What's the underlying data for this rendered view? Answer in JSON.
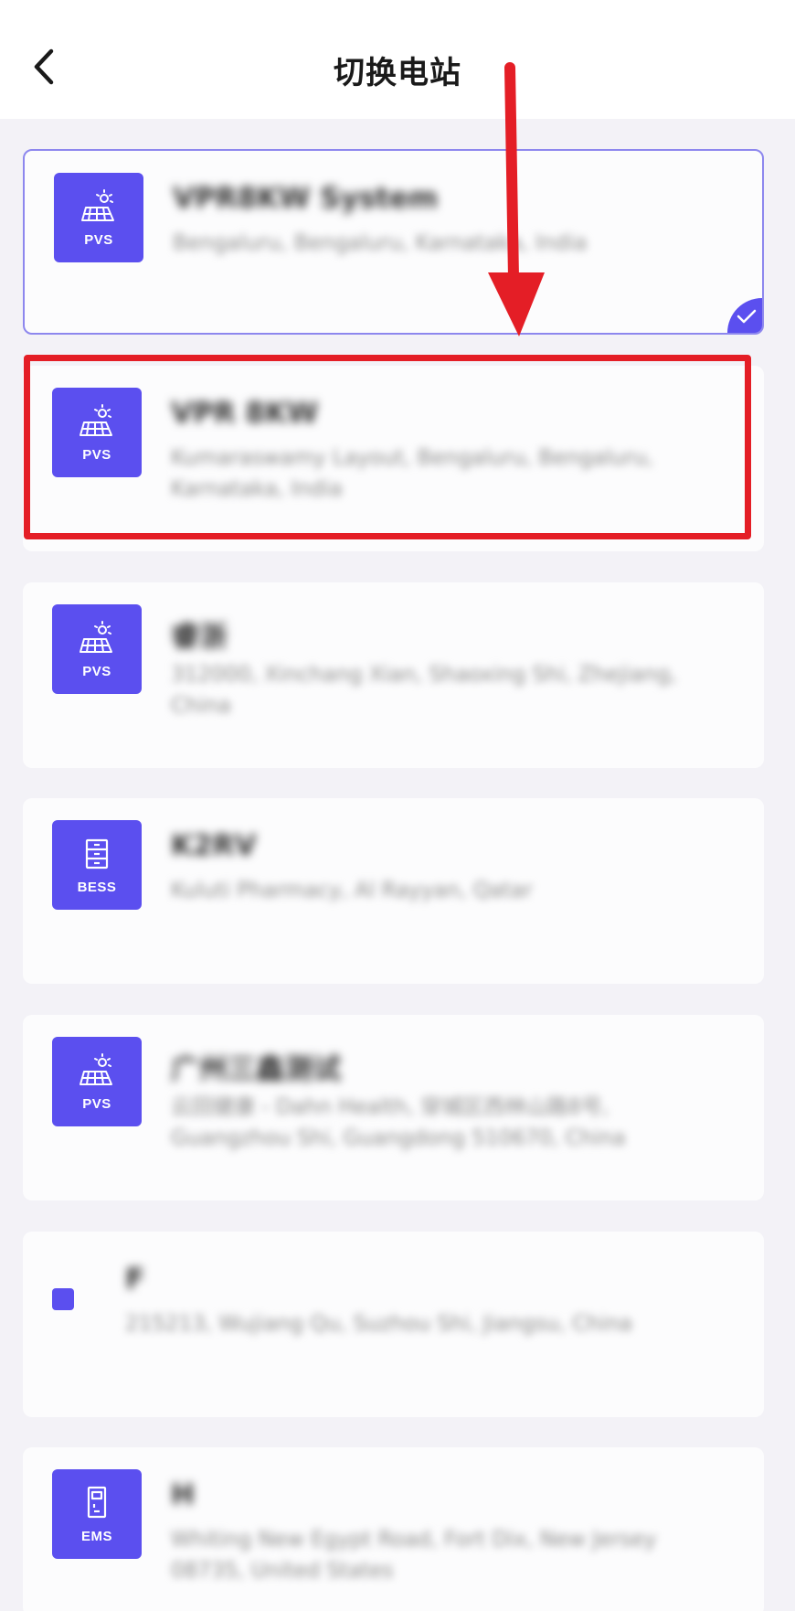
{
  "header": {
    "title": "切换电站"
  },
  "stations": [
    {
      "type": "PVS",
      "icon": "solar-panel-icon",
      "name": "VPR8KW System",
      "address": "Bengaluru, Bengaluru, Karnataka, India",
      "selected": true
    },
    {
      "type": "PVS",
      "icon": "solar-panel-icon",
      "name": "VPR 8KW",
      "address": "Kumaraswamy Layout, Bengaluru, Bengaluru, Karnataka, India",
      "selected": false
    },
    {
      "type": "PVS",
      "icon": "solar-panel-icon",
      "name": "睿浙",
      "address": "312000, Xinchang Xian, Shaoxing Shi, Zhejiang, China",
      "selected": false
    },
    {
      "type": "BESS",
      "icon": "battery-cabinet-icon",
      "name": "K2RV",
      "address": "Kuluti Pharmacy, Al Rayyan, Qatar",
      "selected": false
    },
    {
      "type": "PVS",
      "icon": "solar-panel-icon",
      "name": "广州三鑫测试",
      "address": "云回健康 - Dahn Health, 穿城区西林山路8号, Guangzhou Shi, Guangdong 510670, China",
      "selected": false
    },
    {
      "type": "",
      "icon": "station-icon",
      "name": "F",
      "address": "215213, Wujiang Qu, Suzhou Shi, Jiangsu, China",
      "selected": false
    },
    {
      "type": "EMS",
      "icon": "ems-device-icon",
      "name": "H",
      "address": "Whiting New Egypt Road, Fort Dix, New Jersey 08735, United States",
      "selected": false
    }
  ],
  "colors": {
    "accent": "#5b4fef",
    "annotation": "#e41e26",
    "selected_border": "#8d87ee"
  }
}
